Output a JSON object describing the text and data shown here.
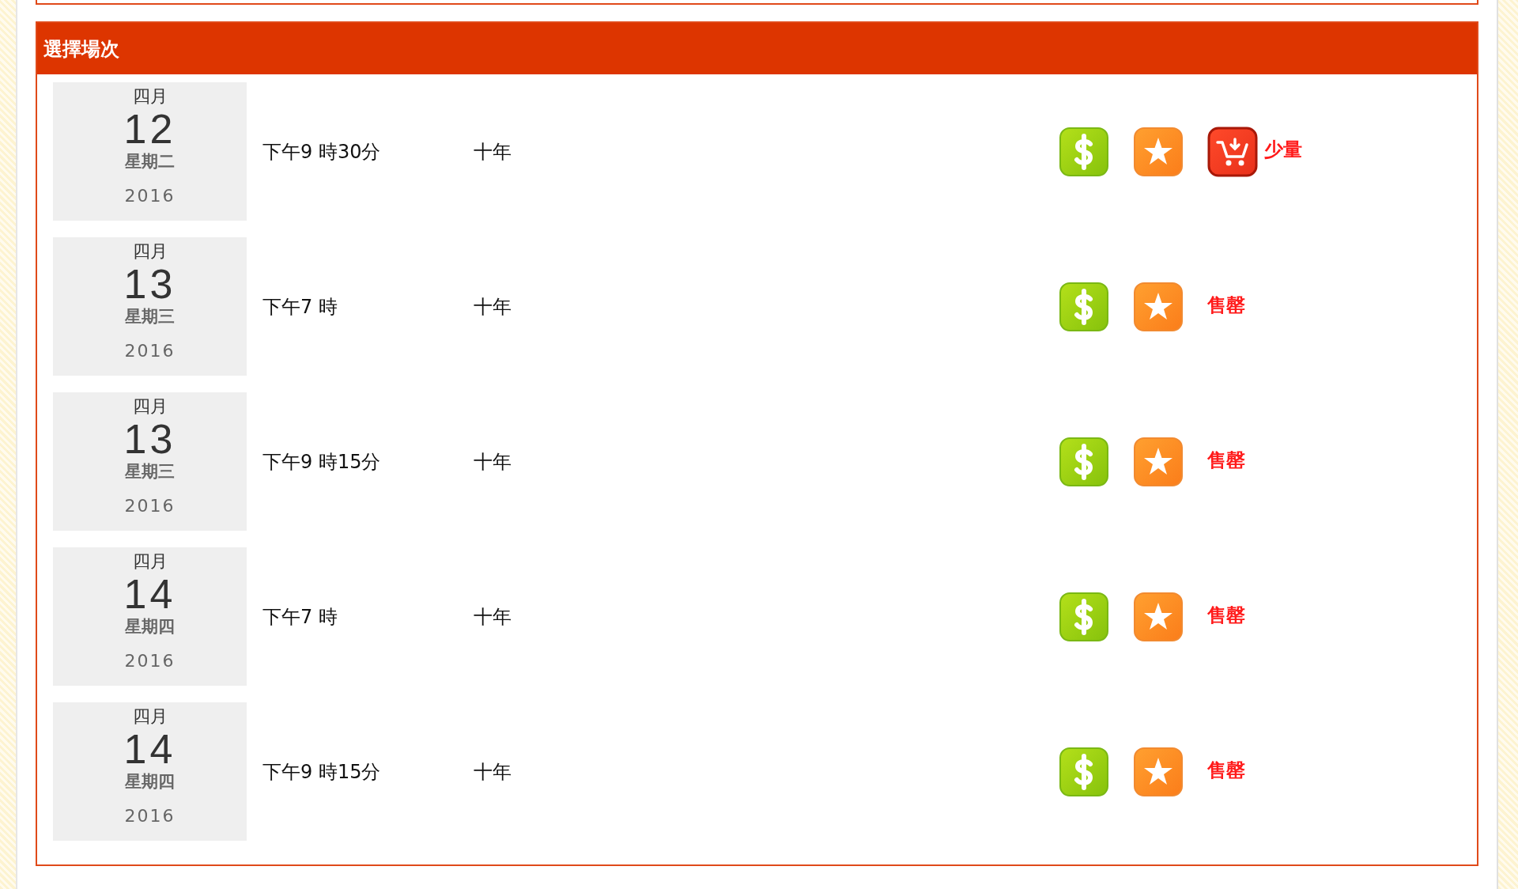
{
  "panel": {
    "title": "選擇場次"
  },
  "sessions": [
    {
      "month": "四月",
      "day": "12",
      "weekday": "星期二",
      "year": "2016",
      "time": "下午9 時30分",
      "show": "十年",
      "status": {
        "kind": "few",
        "label": "少量"
      }
    },
    {
      "month": "四月",
      "day": "13",
      "weekday": "星期三",
      "year": "2016",
      "time": "下午7 時",
      "show": "十年",
      "status": {
        "kind": "soldout",
        "label": "售罄"
      }
    },
    {
      "month": "四月",
      "day": "13",
      "weekday": "星期三",
      "year": "2016",
      "time": "下午9 時15分",
      "show": "十年",
      "status": {
        "kind": "soldout",
        "label": "售罄"
      }
    },
    {
      "month": "四月",
      "day": "14",
      "weekday": "星期四",
      "year": "2016",
      "time": "下午7 時",
      "show": "十年",
      "status": {
        "kind": "soldout",
        "label": "售罄"
      }
    },
    {
      "month": "四月",
      "day": "14",
      "weekday": "星期四",
      "year": "2016",
      "time": "下午9 時15分",
      "show": "十年",
      "status": {
        "kind": "soldout",
        "label": "售罄"
      }
    }
  ]
}
